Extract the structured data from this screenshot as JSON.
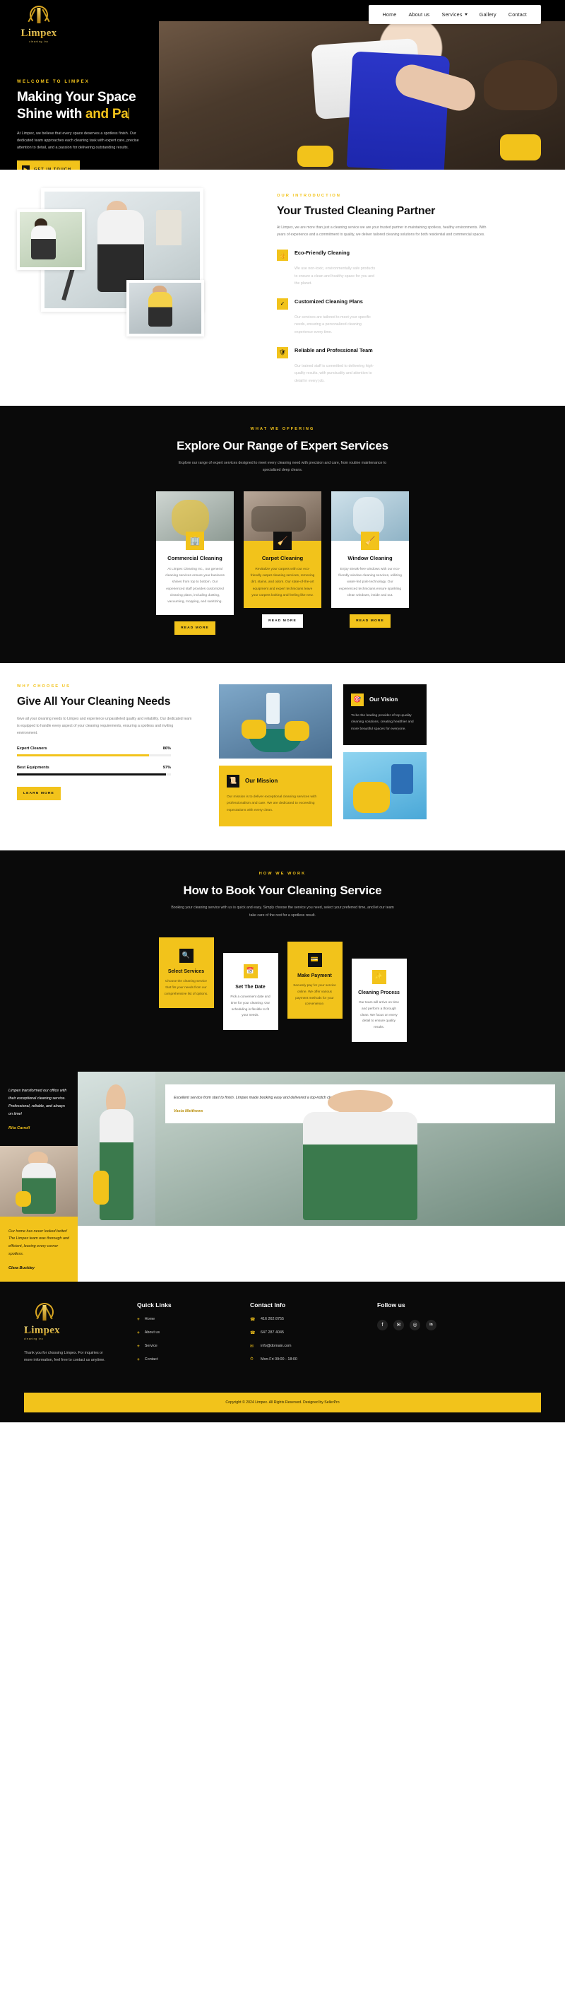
{
  "brand": {
    "name": "Limpex",
    "tagline": "cleaning Inc"
  },
  "nav": {
    "items": [
      {
        "label": "Home"
      },
      {
        "label": "About us"
      },
      {
        "label": "Services",
        "has_dropdown": true
      },
      {
        "label": "Gallery"
      },
      {
        "label": "Contact"
      }
    ]
  },
  "hero": {
    "eyebrow": "WELCOME TO LIMPEX",
    "title_line1": "Making Your Space",
    "title_line2_plain": "Shine with ",
    "title_line2_accent": "and Pa",
    "paragraph": "At Limpex, we believe that every space deserves a spotless finish. Our dedicated team approaches each cleaning task with expert care, precise attention to detail, and a passion for delivering outstanding results.",
    "cta": "GET IN TOUCH",
    "cta_icon": "arrow-right-icon"
  },
  "intro": {
    "eyebrow": "OUR INTRODUCTION",
    "title": "Your Trusted Cleaning Partner",
    "paragraph": "At Limpex, we are more than just a cleaning service we are your trusted partner in maintaining spotless, healthy environments. With years of experience and a commitment to quality, we deliver tailored cleaning solutions for both residential and commercial spaces.",
    "features": [
      {
        "icon": "thumbs-up-icon",
        "title": "Eco-Friendly Cleaning",
        "desc": "We use non-toxic, environmentally safe products to ensure a clean and healthy space for you and the planet."
      },
      {
        "icon": "check-circle-icon",
        "title": "Customized Cleaning Plans",
        "desc": "Our services are tailored to meet your specific needs, ensuring a personalized cleaning experience every time."
      },
      {
        "icon": "shield-icon",
        "title": "Reliable and Professional Team",
        "desc": "Our trained staff is committed to delivering high-quality results, with punctuality and attention to detail in every job."
      }
    ]
  },
  "services": {
    "eyebrow": "WHAT WE OFFERING",
    "title": "Explore Our Range of Expert Services",
    "paragraph": "Explore our range of expert services designed to meet every cleaning need with precision and care, from routine maintenance to specialized deep cleans.",
    "cards": [
      {
        "icon": "building-icon",
        "title": "Commercial Cleaning",
        "desc": "At Limpex Cleaning Inc., our general cleaning services ensure your business shines from top to bottom. Our experienced staff provides customized cleaning plans, including dusting, vacuuming, mopping, and sanitizing.",
        "button": "READ MORE"
      },
      {
        "icon": "carpet-icon",
        "title": "Carpet Cleaning",
        "desc": "Revitalize your carpets with our eco-friendly carpet cleaning services, removing dirt, stains, and odors. Our state-of-the-art equipment and expert technicians leave your carpets looking and feeling like new.",
        "button": "READ MORE"
      },
      {
        "icon": "window-icon",
        "title": "Window Cleaning",
        "desc": "Enjoy streak-free windows with our eco-friendly window cleaning services, utilizing water-fed pole technology. Our experienced technicians ensure sparkling clean windows, inside and out.",
        "button": "READ MORE"
      }
    ]
  },
  "why": {
    "eyebrow": "WHY CHOOSE US",
    "title": "Give All Your Cleaning Needs",
    "paragraph": "Give all your cleaning needs to Limpex and experience unparalleled quality and reliability. Our dedicated team is equipped to handle every aspect of your cleaning requirements, ensuring a spotless and inviting environment.",
    "bars": [
      {
        "label": "Expert Cleaners",
        "value": "86%",
        "pct": 86
      },
      {
        "label": "Best Equipments",
        "value": "97%",
        "pct": 97
      }
    ],
    "cta": "LEARN MORE",
    "vision": {
      "icon": "target-icon",
      "title": "Our Vision",
      "desc": "To be the leading provider of top-quality cleaning solutions, creating healthier and more beautiful spaces for everyone."
    },
    "mission": {
      "icon": "scroll-icon",
      "title": "Our Mission",
      "desc": "Our mission is to deliver exceptional cleaning services with professionalism and care. We are dedicated to exceeding expectations with every clean."
    }
  },
  "how": {
    "eyebrow": "HOW WE WORK",
    "title": "How to Book Your Cleaning Service",
    "paragraph": "Booking your cleaning service with us is quick and easy. Simply choose the service you need, select your preferred time, and let our team take care of the rest for a spotless result.",
    "steps": [
      {
        "icon": "search-icon",
        "title": "Select Services",
        "desc": "Choose the cleaning service that fits your needs from our comprehensive list of options."
      },
      {
        "icon": "calendar-icon",
        "title": "Set The Date",
        "desc": "Pick a convenient date and time for your cleaning. Our scheduling is flexible to fit your needs."
      },
      {
        "icon": "credit-card-icon",
        "title": "Make Payment",
        "desc": "Securely pay for your service online. We offer various payment methods for your convenience."
      },
      {
        "icon": "sparkle-icon",
        "title": "Cleaning Process",
        "desc": "Our team will arrive on time and perform a thorough clean. We focus on every detail to ensure quality results."
      }
    ]
  },
  "testimonials": [
    {
      "text": "Limpex transformed our office with their exceptional cleaning service. Professional, reliable, and always on time!",
      "name": "Rita Carroll"
    },
    {
      "text": "Our home has never looked better! The Limpex team was thorough and efficient, leaving every corner spotless.",
      "name": "Clara Buckley"
    },
    {
      "text": "Excellent service from start to finish. Limpex made booking easy and delivered a top-notch clean for our restaurant.",
      "name": "Vasia Matthews"
    }
  ],
  "footer": {
    "description": "Thank you for choosing Limpex. For inquiries or more information, feel free to contact us anytime.",
    "quick_links_title": "Quick Links",
    "quick_links": [
      "Home",
      "About us",
      "Service",
      "Contact"
    ],
    "contact_title": "Contact Info",
    "contact": [
      {
        "icon": "phone-icon",
        "text": "416 262 8755"
      },
      {
        "icon": "phone-icon",
        "text": "647 287 4045"
      },
      {
        "icon": "mail-icon",
        "text": "info@domain.com"
      },
      {
        "icon": "clock-icon",
        "text": "Mon-Fri 09:00 - 18:00"
      }
    ],
    "follow_title": "Follow us",
    "socials": [
      {
        "icon": "facebook-icon",
        "glyph": "f"
      },
      {
        "icon": "twitter-icon",
        "glyph": "✉"
      },
      {
        "icon": "instagram-icon",
        "glyph": "◎"
      },
      {
        "icon": "linkedin-icon",
        "glyph": "in"
      }
    ],
    "copyright": "Copyright © 2024 Limpex. All Rights Reserved. Designed by SellerPro"
  },
  "colors": {
    "accent": "#f2c31b",
    "dark": "#0a0a0a",
    "muted": "#7c7c7c"
  }
}
